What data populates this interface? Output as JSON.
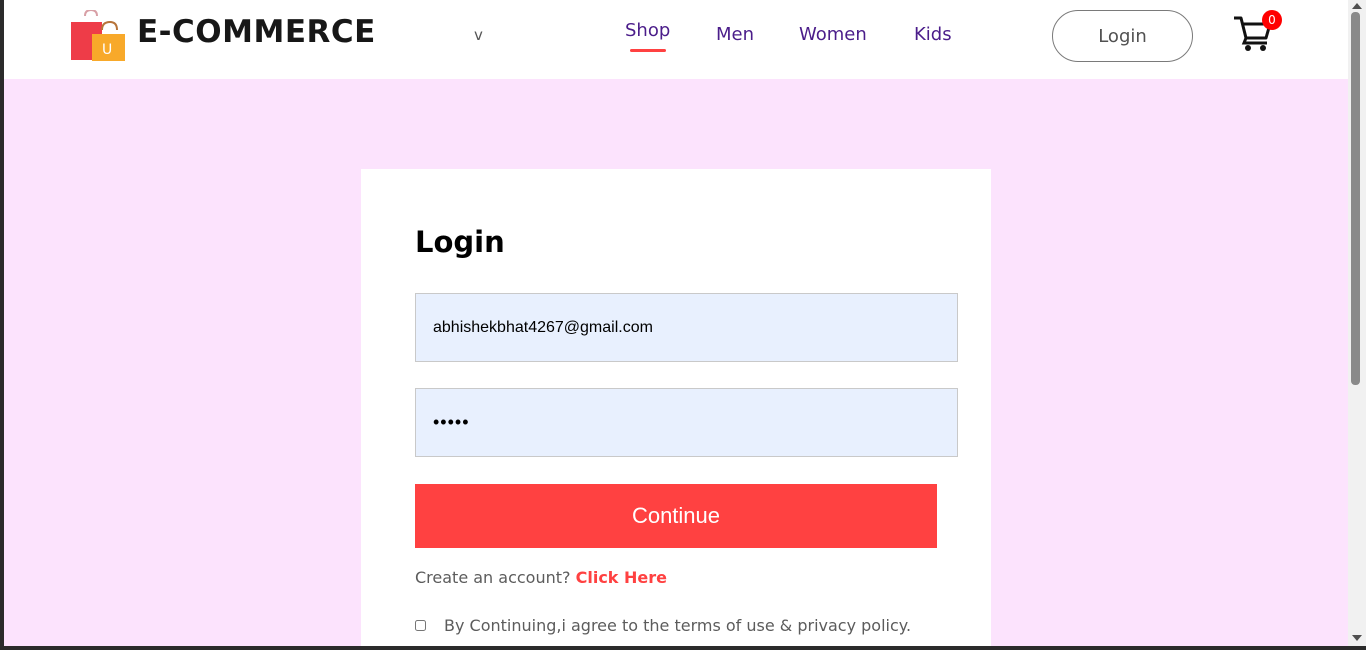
{
  "brand": {
    "name": "E-COMMERCE",
    "logo_letter": "U",
    "logo_icon": "shopping-bags-icon"
  },
  "nav": {
    "dropdown_icon": "v",
    "items": [
      {
        "label": "Shop",
        "active": true
      },
      {
        "label": "Men"
      },
      {
        "label": "Women"
      },
      {
        "label": "Kids"
      }
    ],
    "login_label": "Login",
    "cart_icon": "cart-icon",
    "cart_count": "0"
  },
  "login_form": {
    "title": "Login",
    "email_value": "abhishekbhat4267@gmail.com",
    "password_mask": "•••••",
    "continue_label": "Continue",
    "signup_text": "Create an account?",
    "signup_link": "Click Here",
    "terms_text": "By Continuing,i agree to the terms of use & privacy policy."
  },
  "colors": {
    "accent": "#ff4141",
    "nav_text": "#4b1d8a",
    "page_bg": "#fce3fd",
    "input_bg": "#e8f0fe",
    "badge": "#ff0000"
  }
}
